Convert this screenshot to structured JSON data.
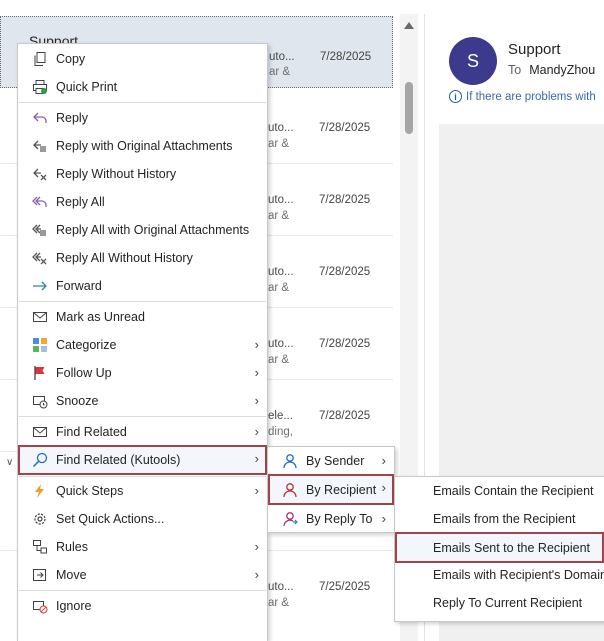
{
  "mail_list": {
    "selected_sender": "Support",
    "rows": [
      {
        "sub1": "uto...",
        "sub2": "ar &",
        "date": "7/28/2025"
      },
      {
        "sub1": "uto...",
        "sub2": "ar &",
        "date": "7/28/2025"
      },
      {
        "sub1": "uto...",
        "sub2": "ar &",
        "date": "7/28/2025"
      },
      {
        "sub1": "uto...",
        "sub2": "ar &",
        "date": "7/28/2025"
      },
      {
        "sub1": "uto...",
        "sub2": "ar &",
        "date": "7/28/2025"
      },
      {
        "sub1": "ele...",
        "sub2": "ding,",
        "date": "7/28/2025"
      },
      {
        "sub1": "",
        "sub2": "",
        "date": ""
      },
      {
        "sub1": "uto...",
        "sub2": "ar &",
        "date": "7/25/2025"
      }
    ]
  },
  "reading_pane": {
    "avatar_letter": "S",
    "sender": "Support",
    "to_label": "To",
    "to_name": "MandyZhou",
    "info_text": "If there are problems with"
  },
  "context_menu": {
    "items": [
      {
        "label": "Copy",
        "icon": "copy-icon"
      },
      {
        "label": "Quick Print",
        "icon": "quick-print-icon"
      },
      {
        "label": "Reply",
        "icon": "reply-icon"
      },
      {
        "label": "Reply with Original Attachments",
        "icon": "reply-attachments-icon"
      },
      {
        "label": "Reply Without History",
        "icon": "reply-no-history-icon"
      },
      {
        "label": "Reply All",
        "icon": "reply-all-icon"
      },
      {
        "label": "Reply All with Original Attachments",
        "icon": "reply-all-attachments-icon"
      },
      {
        "label": "Reply All Without History",
        "icon": "reply-all-no-history-icon"
      },
      {
        "label": "Forward",
        "icon": "forward-icon"
      },
      {
        "label": "Mark as Unread",
        "icon": "envelope-icon"
      },
      {
        "label": "Categorize",
        "icon": "categorize-icon"
      },
      {
        "label": "Follow Up",
        "icon": "flag-icon"
      },
      {
        "label": "Snooze",
        "icon": "snooze-icon"
      },
      {
        "label": "Find Related",
        "icon": "find-related-icon"
      },
      {
        "label": "Find Related (Kutools)",
        "icon": "search-icon"
      },
      {
        "label": "Quick Steps",
        "icon": "lightning-icon"
      },
      {
        "label": "Set Quick Actions...",
        "icon": "gear-icon"
      },
      {
        "label": "Rules",
        "icon": "rules-icon"
      },
      {
        "label": "Move",
        "icon": "move-icon"
      },
      {
        "label": "Ignore",
        "icon": "ignore-icon"
      }
    ]
  },
  "find_related_submenu": {
    "items": [
      {
        "label": "By Sender",
        "icon": "person-icon"
      },
      {
        "label": "By Recipient",
        "icon": "person-red-icon"
      },
      {
        "label": "By Reply To",
        "icon": "person-reply-icon"
      }
    ]
  },
  "by_recipient_submenu": {
    "items": [
      {
        "label": "Emails Contain the Recipient"
      },
      {
        "label": "Emails from the Recipient"
      },
      {
        "label": "Emails Sent to the Recipient"
      },
      {
        "label": "Emails with Recipient's Domain"
      },
      {
        "label": "Reply To Current Recipient"
      }
    ]
  },
  "colors": {
    "highlight_border": "#a1424f",
    "avatar": "#3b3a8c",
    "accent_blue": "#1f5fa8"
  }
}
